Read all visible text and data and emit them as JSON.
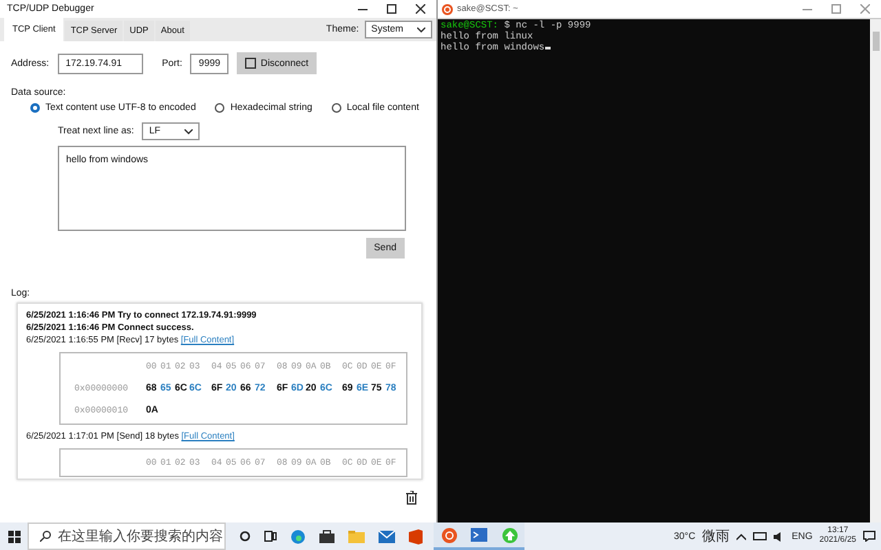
{
  "app": {
    "title": "TCP/UDP Debugger",
    "tabs": [
      {
        "label": "TCP Client",
        "selected": true
      },
      {
        "label": "TCP Server",
        "selected": false
      },
      {
        "label": "UDP",
        "selected": false
      },
      {
        "label": "About",
        "selected": false
      }
    ],
    "theme": {
      "label": "Theme:",
      "value": "System"
    },
    "address": {
      "label": "Address:",
      "value": "172.19.74.91"
    },
    "port": {
      "label": "Port:",
      "value": "9999"
    },
    "connect_button": "Disconnect",
    "data_source": {
      "label": "Data source:",
      "options": [
        {
          "label": "Text content use UTF-8 to encoded",
          "selected": true
        },
        {
          "label": "Hexadecimal string",
          "selected": false
        },
        {
          "label": "Local file content",
          "selected": false
        }
      ]
    },
    "newline": {
      "label": "Treat next line as:",
      "value": "LF"
    },
    "message": "hello from windows",
    "send_button": "Send",
    "log": {
      "label": "Log:",
      "entries": [
        {
          "kind": "status",
          "time": "6/25/2021 1:16:46 PM",
          "text": "Try to connect 172.19.74.91:9999"
        },
        {
          "kind": "status",
          "time": "6/25/2021 1:16:46 PM",
          "text": "Connect success."
        },
        {
          "kind": "data",
          "time": "6/25/2021 1:16:55 PM",
          "text": "[Recv] 17 bytes",
          "link": "[Full Content]",
          "hex": {
            "header": [
              "00",
              "01",
              "02",
              "03",
              "04",
              "05",
              "06",
              "07",
              "08",
              "09",
              "0A",
              "0B",
              "0C",
              "0D",
              "0E",
              "0F"
            ],
            "rows": [
              {
                "offset": "0x00000000",
                "bytes": [
                  "68",
                  "65",
                  "6C",
                  "6C",
                  "6F",
                  "20",
                  "66",
                  "72",
                  "6F",
                  "6D",
                  "20",
                  "6C",
                  "69",
                  "6E",
                  "75",
                  "78"
                ]
              },
              {
                "offset": "0x00000010",
                "bytes": [
                  "0A"
                ]
              }
            ]
          }
        },
        {
          "kind": "data",
          "time": "6/25/2021 1:17:01 PM",
          "text": "[Send] 18 bytes",
          "link": "[Full Content]",
          "hex": {
            "header": [
              "00",
              "01",
              "02",
              "03",
              "04",
              "05",
              "06",
              "07",
              "08",
              "09",
              "0A",
              "0B",
              "0C",
              "0D",
              "0E",
              "0F"
            ]
          }
        }
      ]
    }
  },
  "terminal": {
    "title": "sake@SCST: ~",
    "lines": [
      {
        "prompt": "sake@SCST:",
        "text": " $ nc -l -p 9999"
      },
      {
        "text": "hello from linux"
      },
      {
        "text": "hello from windows"
      }
    ]
  },
  "taskbar": {
    "search_placeholder": "在这里输入你要搜索的内容",
    "temperature": "30°C",
    "weather": "微雨",
    "language": "ENG",
    "time": "13:17",
    "date": "2021/6/25"
  }
}
